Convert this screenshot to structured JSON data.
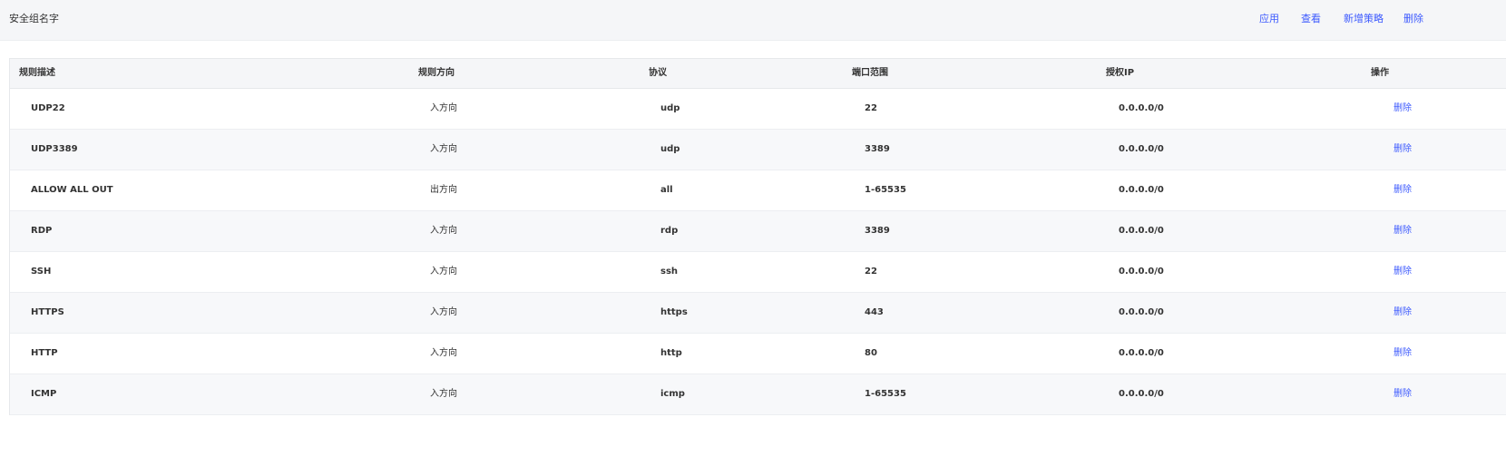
{
  "header": {
    "title": "安全组名字",
    "actions": {
      "apply": "应用",
      "view": "查看",
      "add_policy": "新增策略",
      "delete": "删除"
    }
  },
  "table": {
    "columns": {
      "description": "规则描述",
      "direction": "规则方向",
      "protocol": "协议",
      "port_range": "端口范围",
      "auth_ip": "授权IP",
      "operation": "操作"
    },
    "rows": [
      {
        "description": "UDP22",
        "direction": "入方向",
        "protocol": "udp",
        "port_range": "22",
        "auth_ip": "0.0.0.0/0",
        "action": "删除"
      },
      {
        "description": "UDP3389",
        "direction": "入方向",
        "protocol": "udp",
        "port_range": "3389",
        "auth_ip": "0.0.0.0/0",
        "action": "删除"
      },
      {
        "description": "ALLOW ALL OUT",
        "direction": "出方向",
        "protocol": "all",
        "port_range": "1-65535",
        "auth_ip": "0.0.0.0/0",
        "action": "删除"
      },
      {
        "description": "RDP",
        "direction": "入方向",
        "protocol": "rdp",
        "port_range": "3389",
        "auth_ip": "0.0.0.0/0",
        "action": "删除"
      },
      {
        "description": "SSH",
        "direction": "入方向",
        "protocol": "ssh",
        "port_range": "22",
        "auth_ip": "0.0.0.0/0",
        "action": "删除"
      },
      {
        "description": "HTTPS",
        "direction": "入方向",
        "protocol": "https",
        "port_range": "443",
        "auth_ip": "0.0.0.0/0",
        "action": "删除"
      },
      {
        "description": "HTTP",
        "direction": "入方向",
        "protocol": "http",
        "port_range": "80",
        "auth_ip": "0.0.0.0/0",
        "action": "删除"
      },
      {
        "description": "ICMP",
        "direction": "入方向",
        "protocol": "icmp",
        "port_range": "1-65535",
        "auth_ip": "0.0.0.0/0",
        "action": "删除"
      }
    ]
  },
  "colors": {
    "link": "#3d5afe",
    "header_bg": "#f5f6f8",
    "row_alt_bg": "#f7f8fa"
  }
}
